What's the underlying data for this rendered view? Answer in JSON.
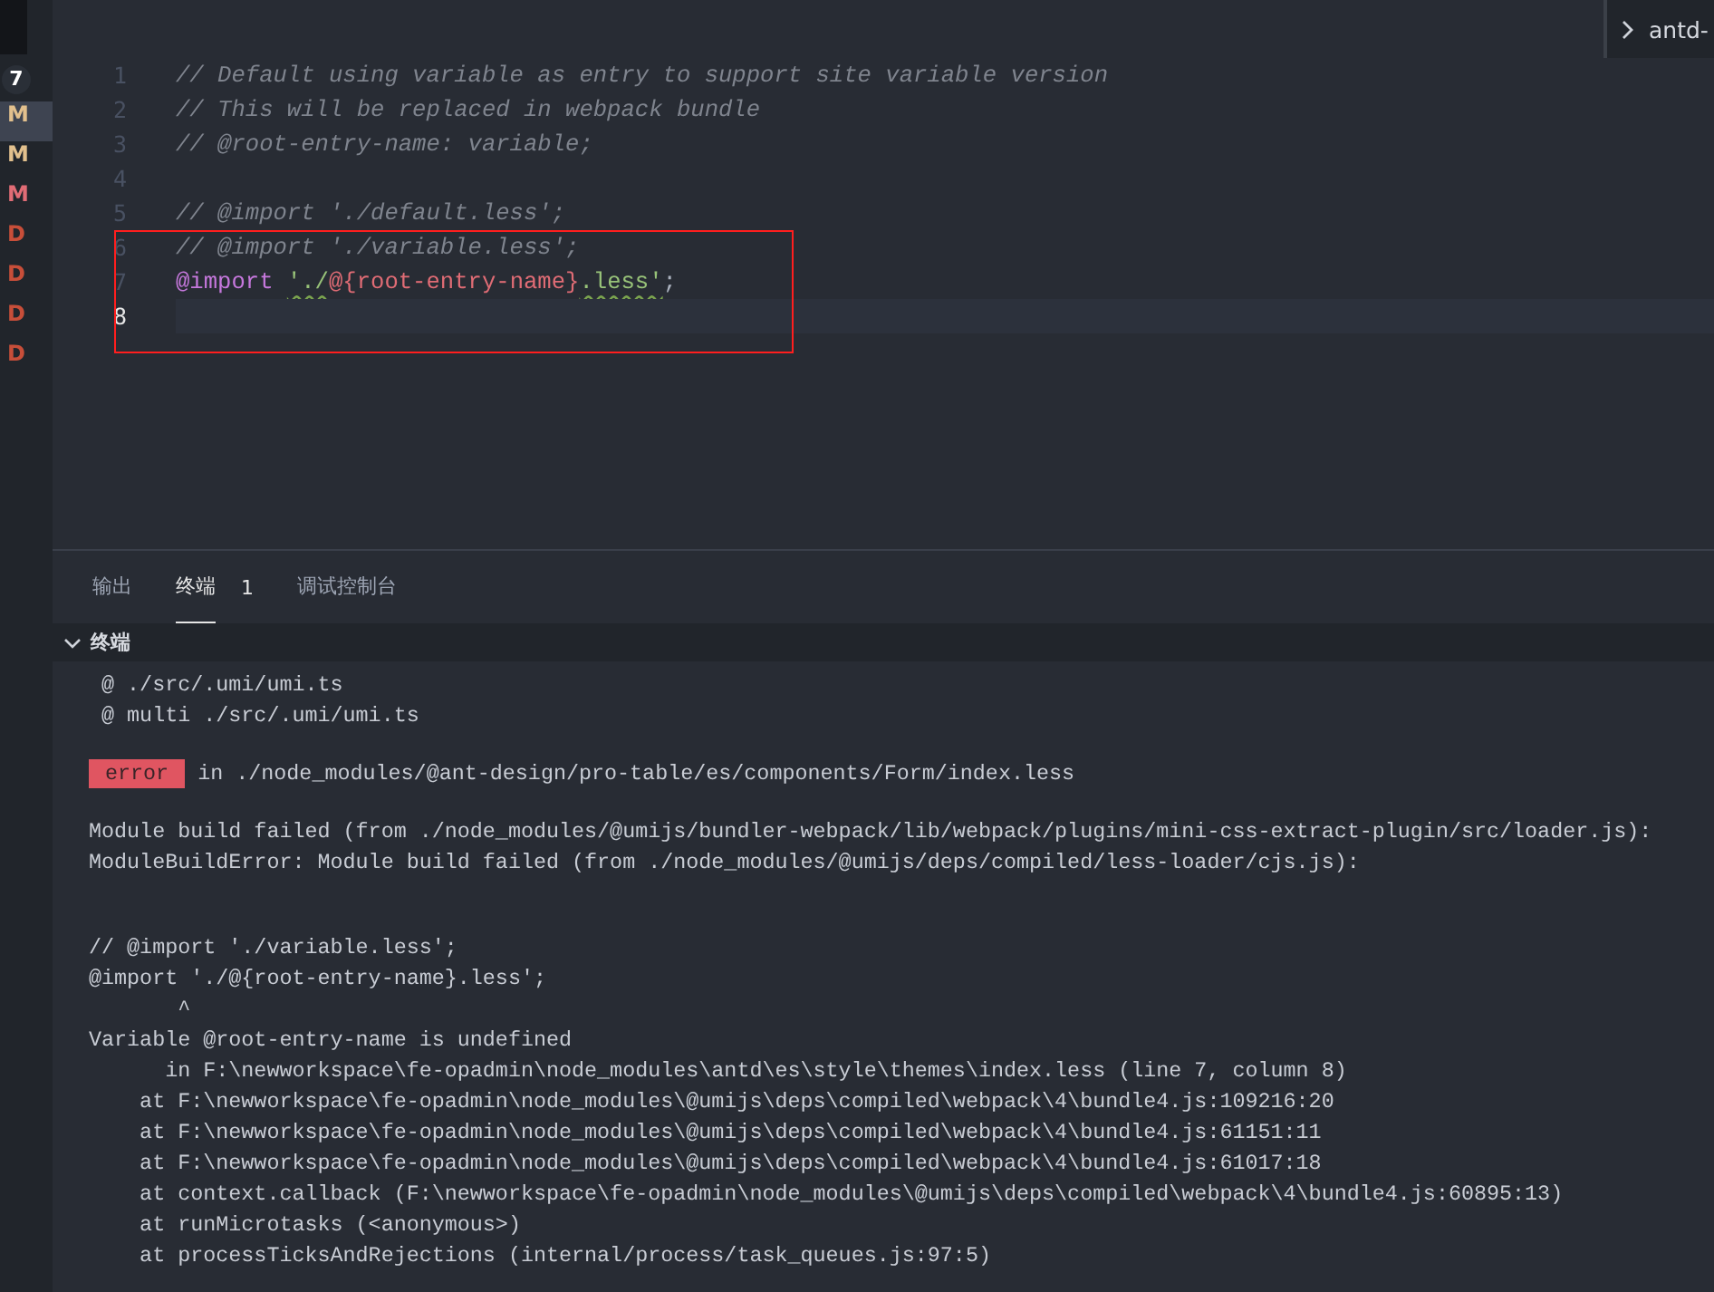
{
  "git_gutter": {
    "badge": "7",
    "items": [
      {
        "letter": "M",
        "color": "#e2c08d",
        "selected": true
      },
      {
        "letter": "M",
        "color": "#e2c08d",
        "selected": false
      },
      {
        "letter": "M",
        "color": "#e06c75",
        "selected": false
      },
      {
        "letter": "D",
        "color": "#c74e39",
        "selected": false
      },
      {
        "letter": "D",
        "color": "#c74e39",
        "selected": false
      },
      {
        "letter": "D",
        "color": "#c74e39",
        "selected": false
      },
      {
        "letter": "D",
        "color": "#c74e39",
        "selected": false
      }
    ]
  },
  "breadcrumb": {
    "text": "antd-"
  },
  "editor": {
    "lines": [
      {
        "number": "1",
        "current": false,
        "tokens": [
          {
            "kind": "comment",
            "text": "// Default using variable as entry to support site variable version"
          }
        ]
      },
      {
        "number": "2",
        "current": false,
        "tokens": [
          {
            "kind": "comment",
            "text": "// This will be replaced in webpack bundle"
          }
        ]
      },
      {
        "number": "3",
        "current": false,
        "tokens": [
          {
            "kind": "comment",
            "text": "// @root-entry-name: variable;"
          }
        ]
      },
      {
        "number": "4",
        "current": false
      },
      {
        "number": "5",
        "current": false,
        "tokens": [
          {
            "kind": "comment",
            "text": "// @import './default.less';"
          }
        ]
      },
      {
        "number": "6",
        "current": false,
        "tokens": [
          {
            "kind": "comment",
            "text": "// @import './variable.less';"
          }
        ]
      },
      {
        "number": "7",
        "current": false,
        "tokens": [
          {
            "kind": "keyword",
            "text": "@import "
          },
          {
            "kind": "string",
            "text": "'./"
          },
          {
            "kind": "variable",
            "text": "@{root-entry-name}"
          },
          {
            "kind": "string",
            "text": ".less'"
          },
          {
            "kind": "plain",
            "text": ";"
          }
        ]
      },
      {
        "number": "8",
        "current": true
      }
    ]
  },
  "panel": {
    "tabs": [
      {
        "label": "输出",
        "selected": false
      },
      {
        "label": "终端",
        "selected": true,
        "count": "1"
      },
      {
        "label": "调试控制台",
        "selected": false
      }
    ],
    "section": {
      "title": "终端",
      "expanded": true
    },
    "terminal_lines": [
      {
        "kind": "text",
        "text": " @ ./src/.umi/umi.ts"
      },
      {
        "kind": "text",
        "text": " @ multi ./src/.umi/umi.ts"
      },
      {
        "kind": "blank"
      },
      {
        "kind": "error",
        "badge": "error",
        "text": "in ./node_modules/@ant-design/pro-table/es/components/Form/index.less"
      },
      {
        "kind": "blank"
      },
      {
        "kind": "text",
        "text": "Module build failed (from ./node_modules/@umijs/bundler-webpack/lib/webpack/plugins/mini-css-extract-plugin/src/loader.js):"
      },
      {
        "kind": "text",
        "text": "ModuleBuildError: Module build failed (from ./node_modules/@umijs/deps/compiled/less-loader/cjs.js):"
      },
      {
        "kind": "blank"
      },
      {
        "kind": "blank"
      },
      {
        "kind": "text",
        "text": "// @import './variable.less';"
      },
      {
        "kind": "text",
        "text": "@import './@{root-entry-name}.less';"
      },
      {
        "kind": "text",
        "text": "       ^"
      },
      {
        "kind": "text",
        "text": "Variable @root-entry-name is undefined"
      },
      {
        "kind": "text",
        "text": "      in F:\\newworkspace\\fe-opadmin\\node_modules\\antd\\es\\style\\themes\\index.less (line 7, column 8)"
      },
      {
        "kind": "text",
        "text": "    at F:\\newworkspace\\fe-opadmin\\node_modules\\@umijs\\deps\\compiled\\webpack\\4\\bundle4.js:109216:20"
      },
      {
        "kind": "text",
        "text": "    at F:\\newworkspace\\fe-opadmin\\node_modules\\@umijs\\deps\\compiled\\webpack\\4\\bundle4.js:61151:11"
      },
      {
        "kind": "text",
        "text": "    at F:\\newworkspace\\fe-opadmin\\node_modules\\@umijs\\deps\\compiled\\webpack\\4\\bundle4.js:61017:18"
      },
      {
        "kind": "text",
        "text": "    at context.callback (F:\\newworkspace\\fe-opadmin\\node_modules\\@umijs\\deps\\compiled\\webpack\\4\\bundle4.js:60895:13)"
      },
      {
        "kind": "text",
        "text": "    at runMicrotasks (<anonymous>)"
      },
      {
        "kind": "text",
        "text": "    at processTicksAndRejections (internal/process/task_queues.js:97:5)"
      }
    ]
  }
}
